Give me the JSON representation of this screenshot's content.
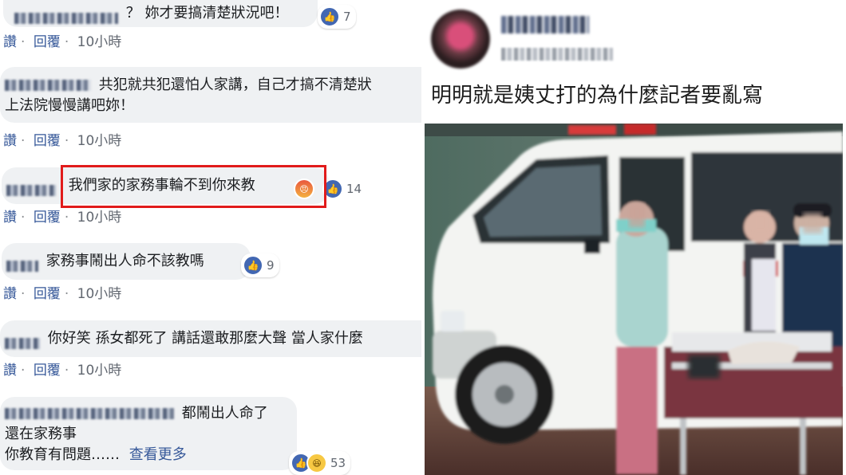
{
  "left_panel": {
    "comments": [
      {
        "text": "？ 妳才要搞清楚狀況吧！",
        "reactions": {
          "icons": [
            "like-icon"
          ],
          "count": "7"
        },
        "actions": {
          "like": "讚",
          "reply": "回覆",
          "time": "10小時"
        }
      },
      {
        "text_lines": [
          "共犯就共犯還怕人家講，自己才搞不清楚狀",
          "上法院慢慢講吧妳！"
        ],
        "actions": {
          "like": "讚",
          "reply": "回覆",
          "time": "10小時"
        }
      },
      {
        "text": "我們家的家務事輪不到你來教",
        "reactions": {
          "icons": [
            "angry-icon",
            "like-icon"
          ],
          "count": "14"
        },
        "actions": {
          "like": "讚",
          "reply": "回覆",
          "time": "10小時"
        }
      },
      {
        "text": "家務事鬧出人命不該教嗎",
        "reactions": {
          "icons": [
            "like-icon"
          ],
          "count": "9"
        },
        "actions": {
          "like": "讚",
          "reply": "回覆",
          "time": "10小時"
        }
      },
      {
        "text": "你好笑 孫女都死了 講話還敢那麼大聲 當人家什麼",
        "actions": {
          "like": "讚",
          "reply": "回覆",
          "time": "10小時"
        }
      },
      {
        "text_lines": [
          "都鬧出人命了",
          "還在家務事",
          "你教育有問題……"
        ],
        "see_more": "查看更多",
        "reactions": {
          "icons": [
            "like-icon",
            "haha-icon"
          ],
          "count": "53"
        }
      }
    ]
  },
  "right_panel": {
    "post_text": "明明就是姨丈打的為什麼記者要亂寫"
  },
  "colors": {
    "highlight": "#e11b1b",
    "link": "#365899",
    "bubble": "#eff1f3",
    "like": "#4267b2"
  }
}
